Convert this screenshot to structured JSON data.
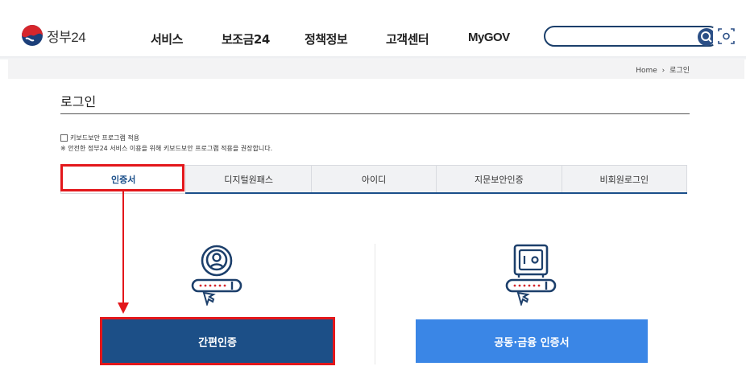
{
  "header": {
    "logo_text": "정부24",
    "nav": [
      "서비스",
      "보조금24",
      "정책정보",
      "고객센터",
      "MyGOV"
    ],
    "search": {
      "value": "",
      "placeholder": ""
    }
  },
  "breadcrumb": {
    "home": "Home",
    "separator": "›",
    "current": "로그인"
  },
  "page": {
    "title": "로그인",
    "keyboard_security_label": "키보드보안 프로그램 적용",
    "keyboard_security_note": "※ 안전한 정부24 서비스 이용을 위해 키보드보안 프로그램 적용을 권장합니다."
  },
  "tabs": [
    "인증서",
    "디지털원패스",
    "아이디",
    "지문보안인증",
    "비회원로그인"
  ],
  "buttons": {
    "simple_auth": "간편인증",
    "joint_cert": "공동·금융 인증서"
  },
  "colors": {
    "primary": "#1c4f87",
    "secondary_button": "#3a86e6",
    "highlight": "#e3171b"
  },
  "icons": [
    "search-icon",
    "face-scan-icon",
    "user-circle-icon",
    "safe-icon",
    "login-key-icon"
  ]
}
